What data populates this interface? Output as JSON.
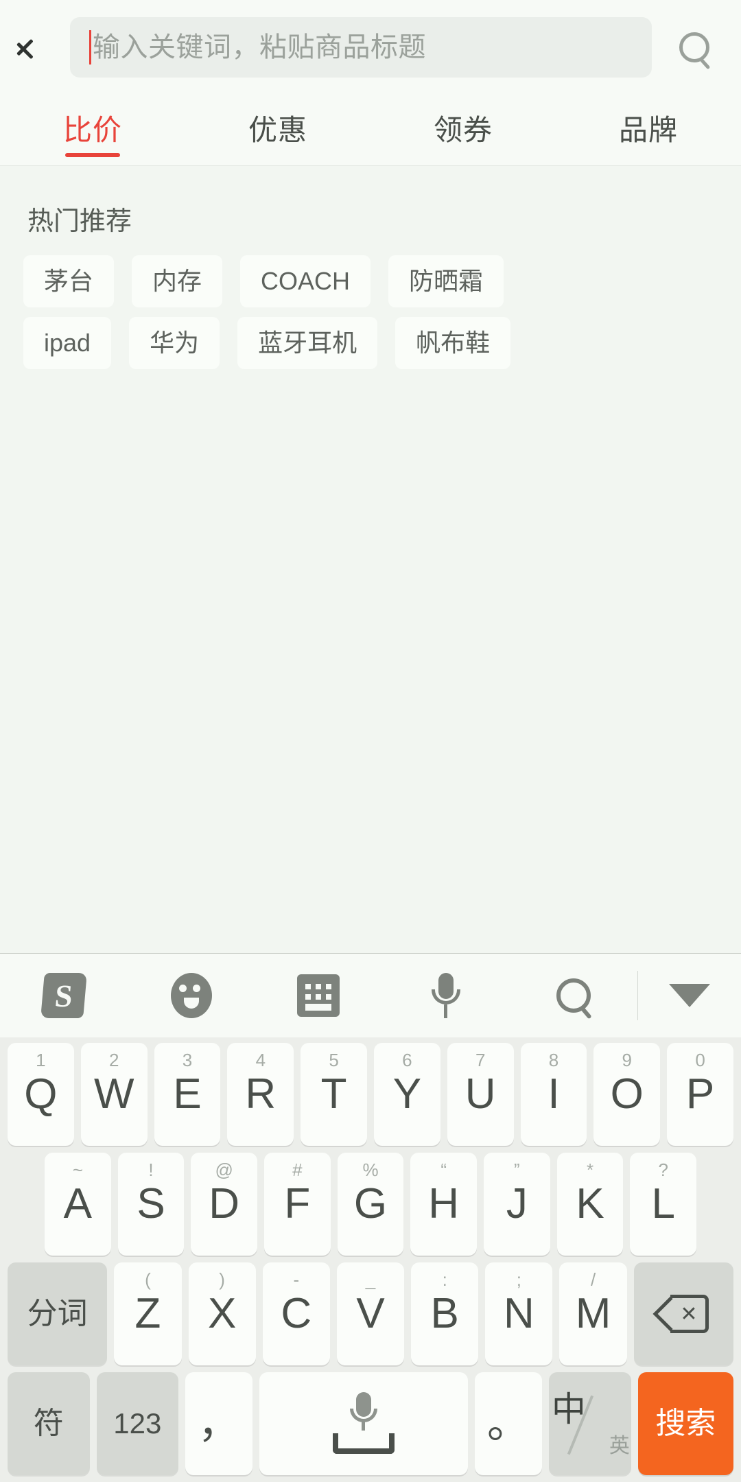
{
  "topbar": {
    "back_icon": "back-chevron-icon",
    "search_placeholder": "输入关键词，粘贴商品标题",
    "search_value": "",
    "search_icon": "search-icon"
  },
  "tabs": [
    {
      "label": "比价",
      "active": true
    },
    {
      "label": "优惠",
      "active": false
    },
    {
      "label": "领券",
      "active": false
    },
    {
      "label": "品牌",
      "active": false
    }
  ],
  "content": {
    "section_title": "热门推荐",
    "chip_rows": [
      [
        "茅台",
        "内存",
        "COACH",
        "防晒霜"
      ],
      [
        "ipad",
        "华为",
        "蓝牙耳机",
        "帆布鞋"
      ]
    ]
  },
  "keyboard": {
    "toolbar": [
      {
        "name": "sogou-logo-icon",
        "glyph": "S"
      },
      {
        "name": "emoji-icon",
        "glyph": ""
      },
      {
        "name": "keyboard-layout-icon",
        "glyph": ""
      },
      {
        "name": "voice-input-icon",
        "glyph": ""
      },
      {
        "name": "keyboard-search-icon",
        "glyph": ""
      },
      {
        "name": "collapse-keyboard-icon",
        "glyph": ""
      }
    ],
    "row1": [
      {
        "main": "Q",
        "hint": "1"
      },
      {
        "main": "W",
        "hint": "2"
      },
      {
        "main": "E",
        "hint": "3"
      },
      {
        "main": "R",
        "hint": "4"
      },
      {
        "main": "T",
        "hint": "5"
      },
      {
        "main": "Y",
        "hint": "6"
      },
      {
        "main": "U",
        "hint": "7"
      },
      {
        "main": "I",
        "hint": "8"
      },
      {
        "main": "O",
        "hint": "9"
      },
      {
        "main": "P",
        "hint": "0"
      }
    ],
    "row2": [
      {
        "main": "A",
        "hint": "~"
      },
      {
        "main": "S",
        "hint": "!"
      },
      {
        "main": "D",
        "hint": "@"
      },
      {
        "main": "F",
        "hint": "#"
      },
      {
        "main": "G",
        "hint": "%"
      },
      {
        "main": "H",
        "hint": "“"
      },
      {
        "main": "J",
        "hint": "”"
      },
      {
        "main": "K",
        "hint": "*"
      },
      {
        "main": "L",
        "hint": "?"
      }
    ],
    "row3": [
      {
        "main": "分词",
        "hint": ""
      },
      {
        "main": "Z",
        "hint": "("
      },
      {
        "main": "X",
        "hint": ")"
      },
      {
        "main": "C",
        "hint": "-"
      },
      {
        "main": "V",
        "hint": "_"
      },
      {
        "main": "B",
        "hint": ":"
      },
      {
        "main": "N",
        "hint": ";"
      },
      {
        "main": "M",
        "hint": "/"
      },
      {
        "main": "",
        "hint": ""
      }
    ],
    "row3_backspace_name": "backspace-key",
    "row4": {
      "symbols": "符",
      "numbers": "123",
      "comma": "，",
      "space": "",
      "period": "。",
      "lang_zh": "中",
      "lang_en": "英",
      "enter": "搜索"
    }
  },
  "colors": {
    "accent_red": "#e8433a",
    "enter_orange": "#f4651f",
    "page_bg": "#f2f6f1",
    "panel_bg": "#f7faf6",
    "key_bg": "#fbfdfa",
    "key_gray": "#d5d8d3"
  }
}
